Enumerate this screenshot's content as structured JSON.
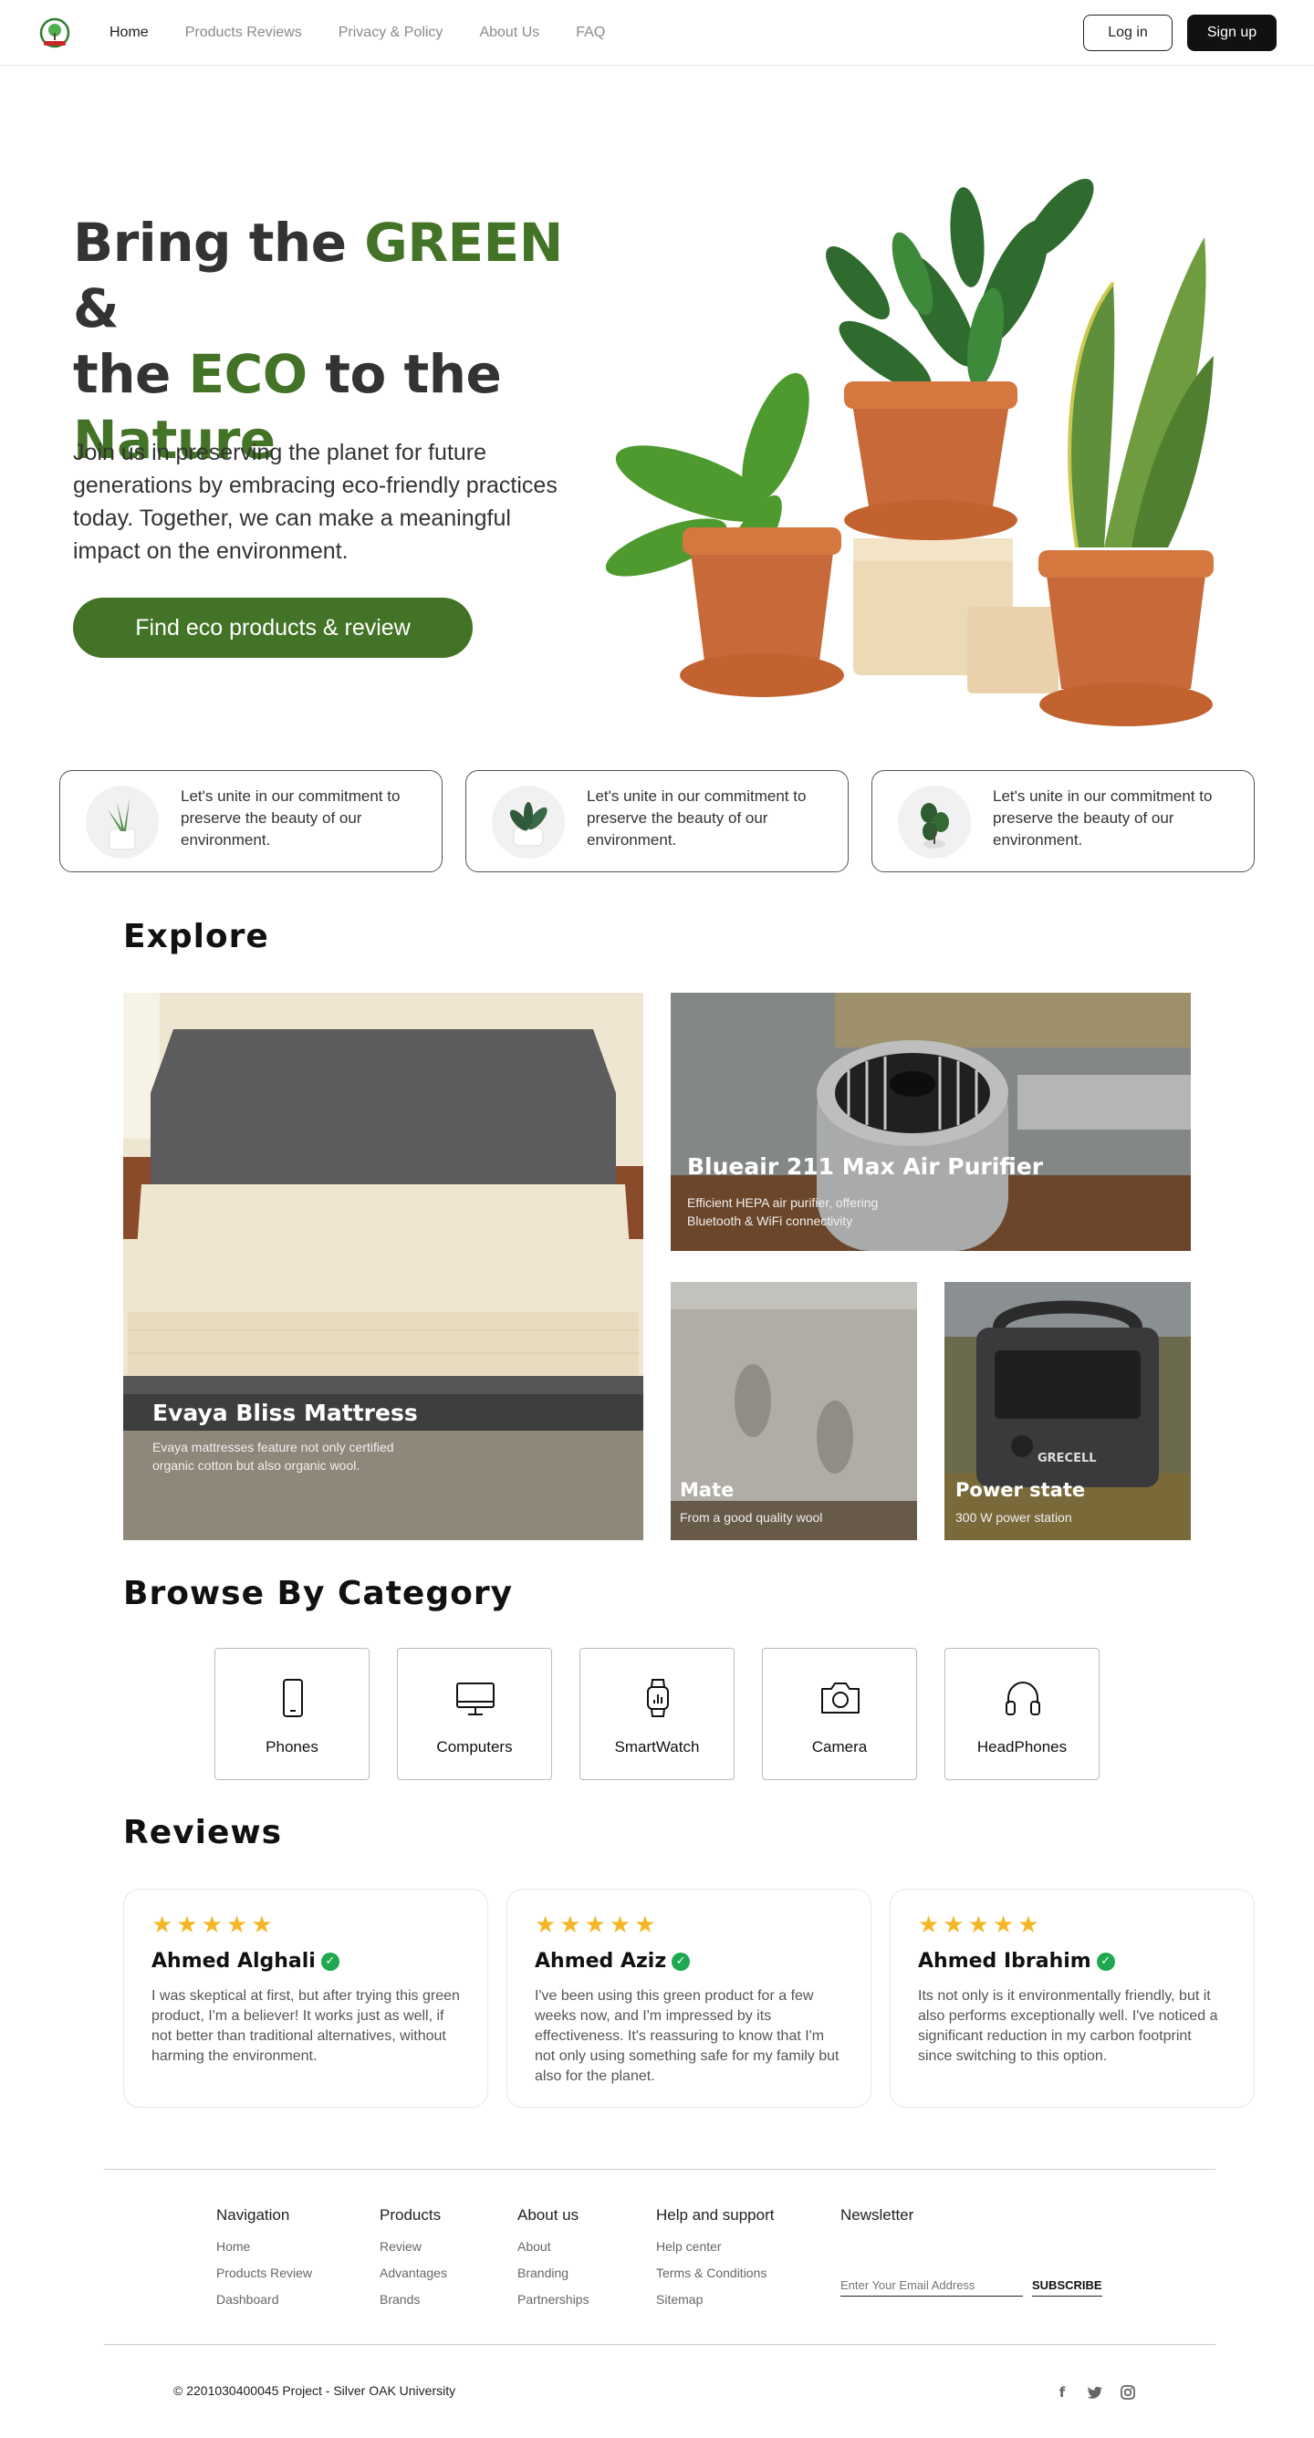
{
  "nav": {
    "links": [
      "Home",
      "Products Reviews",
      "Privacy & Policy",
      "About Us",
      "FAQ"
    ],
    "login_label": "Log in",
    "signup_label": "Sign up"
  },
  "hero": {
    "title_parts": [
      "Bring the ",
      "GREEN",
      " &",
      "the ",
      "ECO",
      " to the",
      "Nature"
    ],
    "description": "Join us in preserving the planet for future generations by embracing eco-friendly practices today. Together, we can make a meaningful impact on the environment.",
    "cta_label": "Find eco products & review"
  },
  "features": [
    {
      "text": "Let's unite in our commitment to preserve the beauty of our environment."
    },
    {
      "text": "Let's unite in our commitment to preserve the beauty of our environment."
    },
    {
      "text": "Let's unite in our commitment to preserve the beauty of our environment."
    }
  ],
  "explore": {
    "title": "Explore",
    "cards": [
      {
        "title": "Evaya Bliss Mattress",
        "desc": "Evaya mattresses feature not only certified organic cotton but also organic wool."
      },
      {
        "title": "Blueair 211 Max Air Purifier",
        "desc": "Efficient HEPA air purifier, offering Bluetooth & WiFi connectivity"
      },
      {
        "title": "Mate",
        "desc": "From a good quality wool"
      },
      {
        "title": "Power state",
        "desc": "300 W power station",
        "brand": "GRECELL"
      }
    ]
  },
  "categories": {
    "title": "Browse By Category",
    "items": [
      {
        "label": "Phones",
        "icon": "phone-icon"
      },
      {
        "label": "Computers",
        "icon": "computer-icon"
      },
      {
        "label": "SmartWatch",
        "icon": "smartwatch-icon"
      },
      {
        "label": "Camera",
        "icon": "camera-icon"
      },
      {
        "label": "HeadPhones",
        "icon": "headphones-icon"
      }
    ]
  },
  "reviews": {
    "title": "Reviews",
    "stars": "★★★★★",
    "items": [
      {
        "name": "Ahmed Alghali",
        "text": "I was skeptical at first, but after trying this green product, I'm a believer! It works just as well, if not better than traditional alternatives, without harming the environment."
      },
      {
        "name": "Ahmed Aziz",
        "text": "I've been using this green product for a few weeks now, and I'm impressed by its effectiveness. It's reassuring to know that I'm not only using something safe for my family but also for the planet."
      },
      {
        "name": "Ahmed Ibrahim",
        "text": "Its not only is it environmentally friendly, but it also performs exceptionally well. I've noticed a significant reduction in my carbon footprint since switching to this option."
      }
    ]
  },
  "footer": {
    "columns": [
      {
        "head": "Navigation",
        "links": [
          "Home",
          "Products Review",
          "Dashboard"
        ]
      },
      {
        "head": "Products",
        "links": [
          "Review",
          "Advantages",
          "Brands"
        ]
      },
      {
        "head": "About us",
        "links": [
          "About",
          "Branding",
          "Partnerships"
        ]
      },
      {
        "head": "Help and support",
        "links": [
          "Help center",
          "Terms & Conditions",
          "Sitemap"
        ]
      }
    ],
    "newsletter": {
      "head": "Newsletter",
      "placeholder": "Enter Your Email Address",
      "button": "SUBSCRIBE"
    },
    "copyright": "© 2201030400045 Project - Silver OAK University",
    "social": [
      "facebook-icon",
      "twitter-icon",
      "instagram-icon"
    ]
  },
  "colors": {
    "accent": "#437326",
    "dark": "#111111",
    "star": "#f5b625",
    "verified": "#1fa84f"
  }
}
